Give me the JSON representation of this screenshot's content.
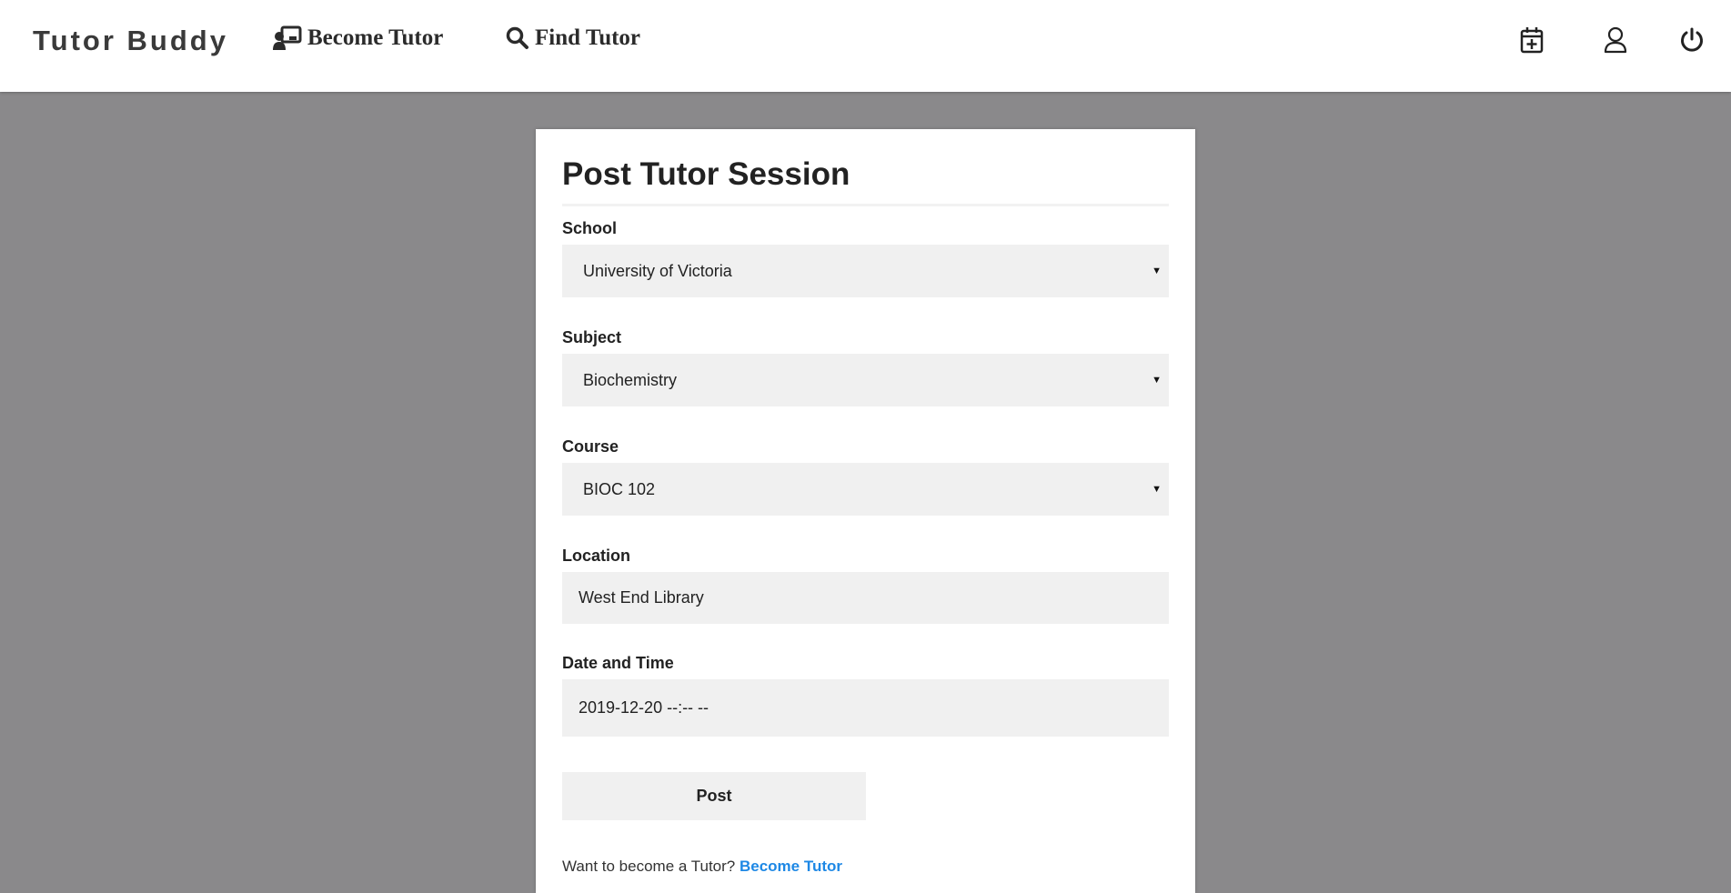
{
  "nav": {
    "brand": "Tutor Buddy",
    "become_tutor": "Become Tutor",
    "find_tutor": "Find Tutor",
    "icons": [
      "calendar-plus-icon",
      "user-icon",
      "power-icon"
    ]
  },
  "form": {
    "title": "Post Tutor Session",
    "school": {
      "label": "School",
      "value": "University of Victoria"
    },
    "subject": {
      "label": "Subject",
      "value": "Biochemistry"
    },
    "course": {
      "label": "Course",
      "value": "BIOC 102"
    },
    "location": {
      "label": "Location",
      "value": "West End Library"
    },
    "datetime": {
      "label": "Date and Time",
      "value": "2019-12-20 --:-- --"
    },
    "post_button": "Post",
    "footer_text": "Want to become a Tutor?",
    "footer_link": "Become Tutor"
  },
  "colors": {
    "background": "#8a898b",
    "navbar": "#ffffff",
    "field": "#f0f0f0",
    "link": "#1e88e5"
  }
}
